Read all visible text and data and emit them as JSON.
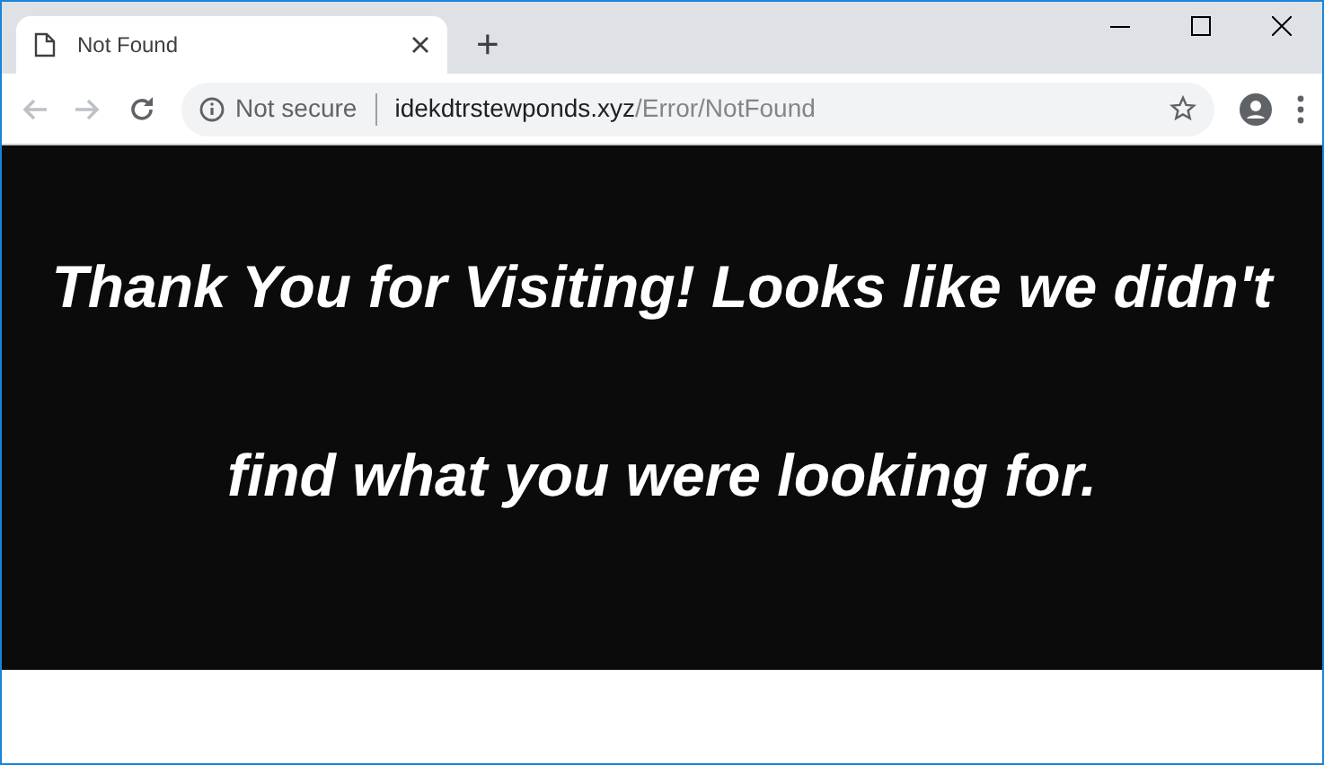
{
  "tab": {
    "title": "Not Found",
    "selected": true
  },
  "new_tab": "+",
  "toolbar": {
    "back_disabled": true,
    "forward_disabled": true,
    "security": "Not secure",
    "url_host": "idekdtrstewponds.xyz",
    "url_path": "/Error/NotFound"
  },
  "page": {
    "message": "Thank You for Visiting! Looks like we didn't find what you were looking for."
  }
}
